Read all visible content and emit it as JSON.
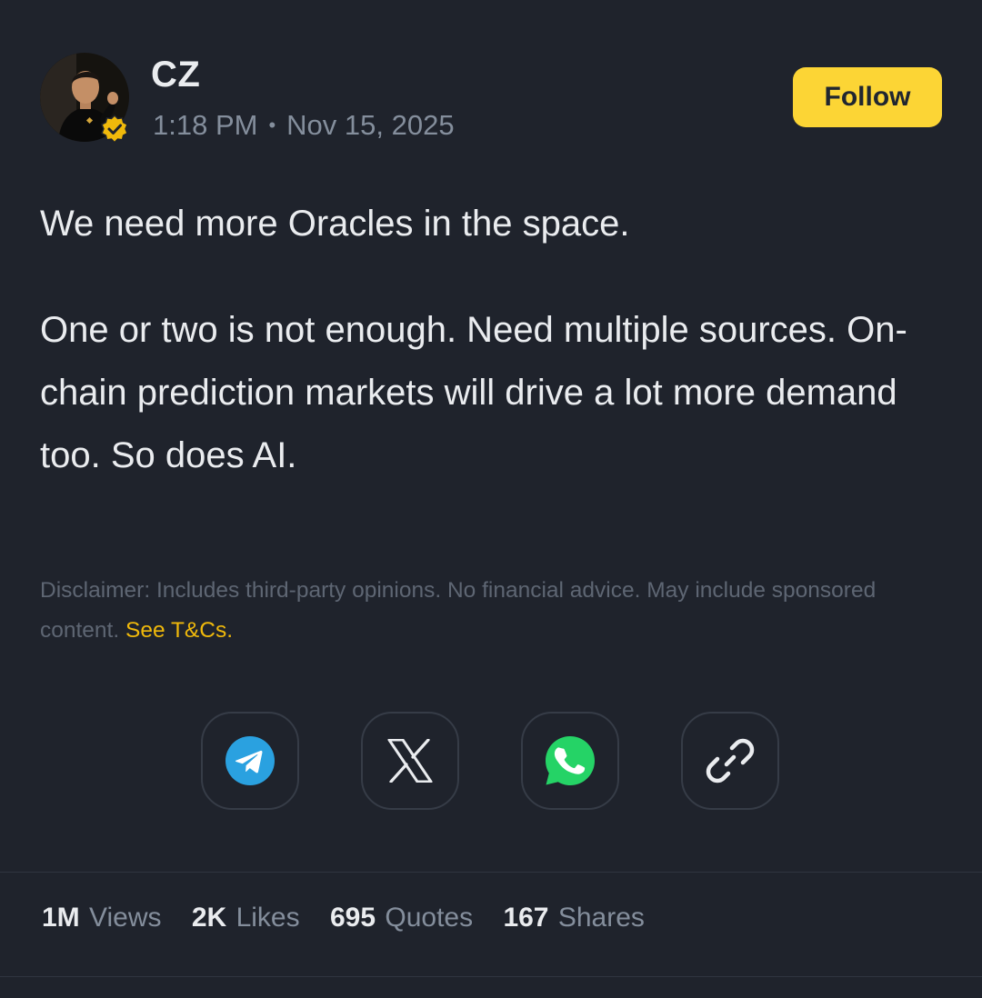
{
  "author": {
    "name": "CZ",
    "time": "1:18 PM",
    "separator": "•",
    "date": "Nov 15, 2025",
    "verified": true
  },
  "follow_label": "Follow",
  "post": {
    "paragraph1": "We need more Oracles in the space.",
    "paragraph2": "One or two is not enough. Need multiple sources. On-chain prediction markets will drive a lot more demand too. So does AI."
  },
  "disclaimer": {
    "text": "Disclaimer: Includes third-party opinions. No financial advice. May include sponsored content. ",
    "link": "See T&Cs."
  },
  "share": [
    {
      "icon": "telegram-icon"
    },
    {
      "icon": "x-icon"
    },
    {
      "icon": "whatsapp-icon"
    },
    {
      "icon": "link-icon"
    }
  ],
  "stats": [
    {
      "value": "1M",
      "label": "Views"
    },
    {
      "value": "2K",
      "label": "Likes"
    },
    {
      "value": "695",
      "label": "Quotes"
    },
    {
      "value": "167",
      "label": "Shares"
    }
  ],
  "colors": {
    "background": "#1f232c",
    "accent": "#fcd535",
    "link": "#f0b90b",
    "telegram": "#2aa1e0",
    "whatsapp": "#25d366"
  }
}
